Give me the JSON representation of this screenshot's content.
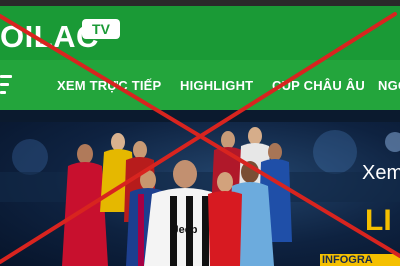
{
  "header": {
    "logo_text": "OILAC",
    "badge_text": "TV",
    "brand_color": "#1a9a36"
  },
  "nav": {
    "menu_icon": "hamburger-menu-icon",
    "items": [
      {
        "label": "XEM TRỰC TIẾP"
      },
      {
        "label": "HIGHLIGHT"
      },
      {
        "label": "CUP CHÂU ÂU"
      },
      {
        "label": "NGO"
      }
    ]
  },
  "banner": {
    "side_text": "Xem",
    "side_text_2": "LI",
    "side_text_3": "INFOGRA",
    "shirt_text": "Jeep"
  },
  "overlay": {
    "cross_color": "#d8241f"
  }
}
